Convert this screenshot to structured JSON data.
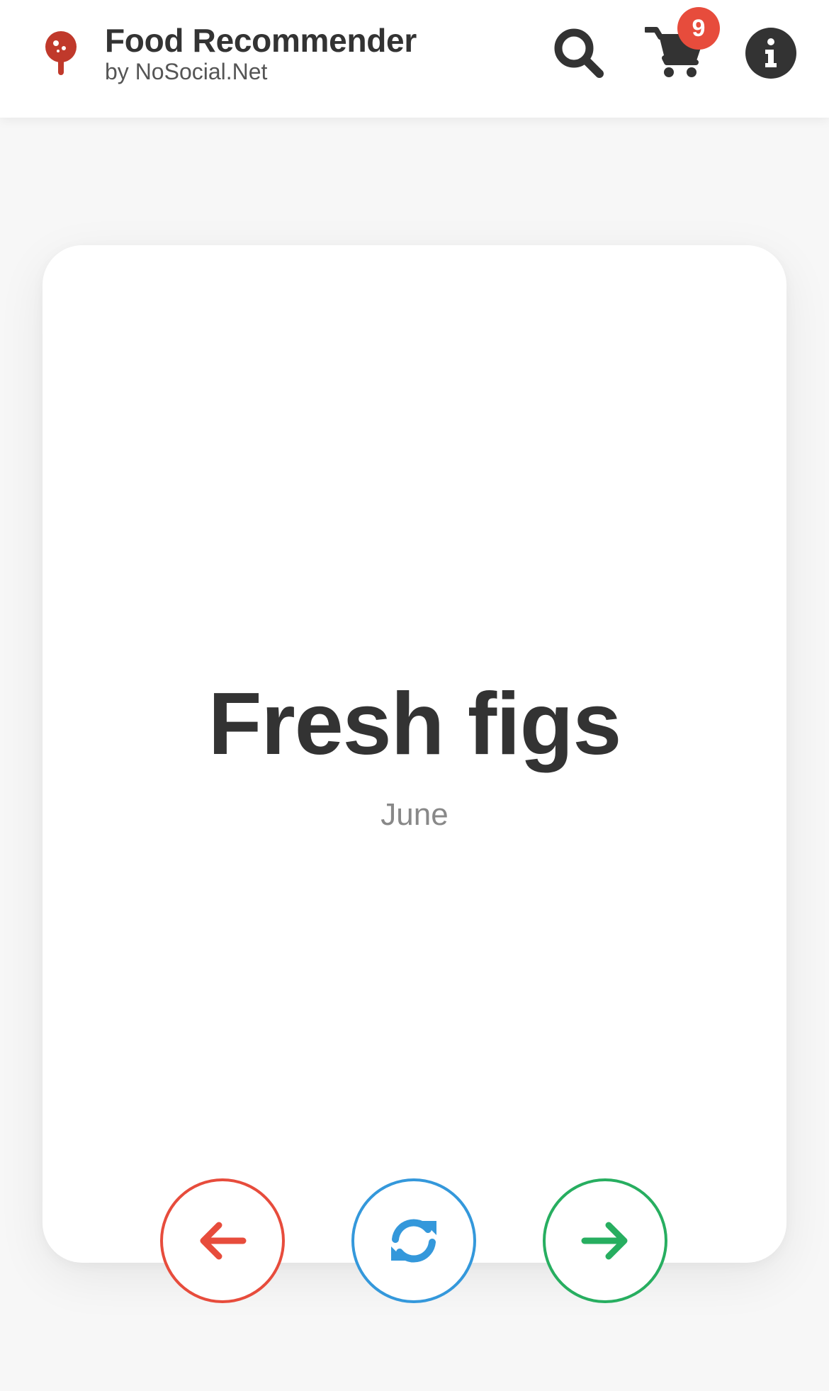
{
  "app": {
    "title": "Food Recommender",
    "subtitle": "by NoSocial.Net",
    "brand_color": "#c0392b"
  },
  "header": {
    "icons": [
      "search-icon",
      "cart-icon",
      "info-icon"
    ],
    "cart_count": "9",
    "badge_color": "#e74c3c"
  },
  "card": {
    "food_name": "Fresh figs",
    "month": "June"
  },
  "actions": [
    {
      "name": "previous",
      "icon": "arrow-left-icon",
      "color": "#e74c3c"
    },
    {
      "name": "shuffle",
      "icon": "sync-icon",
      "color": "#3498db"
    },
    {
      "name": "next",
      "icon": "arrow-right-icon",
      "color": "#27ae60"
    }
  ]
}
